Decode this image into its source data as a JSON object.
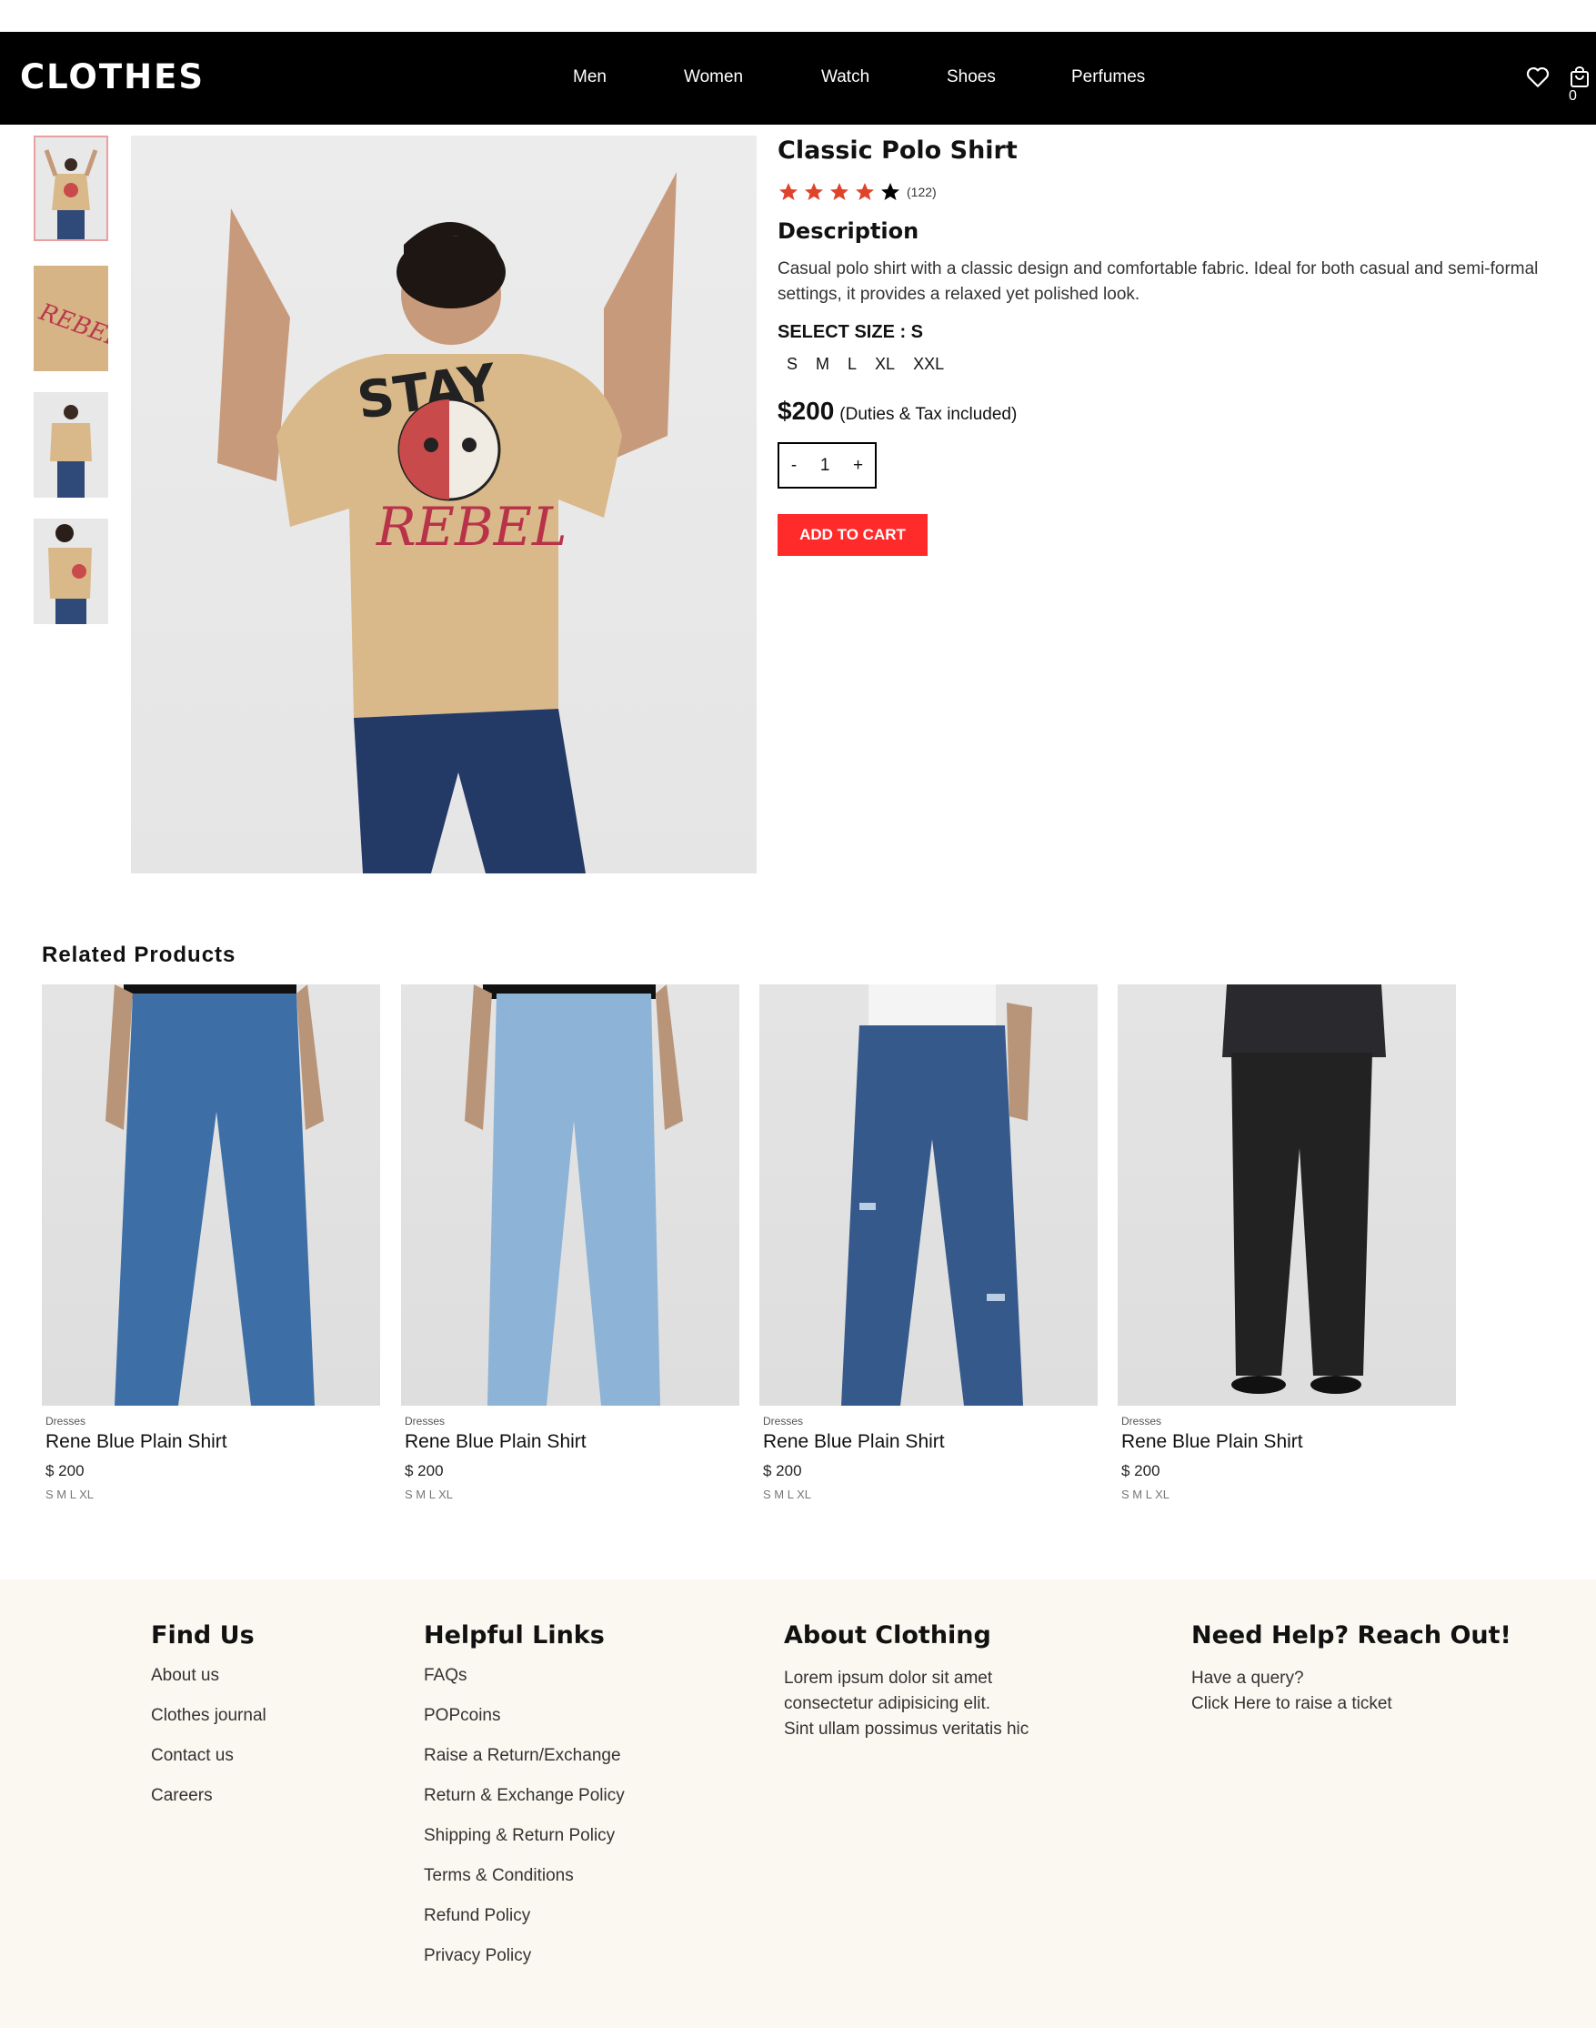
{
  "header": {
    "logo": "CLOTHES",
    "nav": [
      "Men",
      "Women",
      "Watch",
      "Shoes",
      "Perfumes"
    ],
    "cart_count": "0",
    "icons": [
      "heart-icon",
      "shopping-bag-icon"
    ]
  },
  "product": {
    "title": "Classic Polo Shirt",
    "rating": 4,
    "rating_max": 5,
    "review_count": "(122)",
    "description_heading": "Description",
    "description": "Casual polo shirt with a classic design and comfortable fabric. Ideal for both casual and semi-formal settings, it provides a relaxed yet polished look.",
    "size_heading": "SELECT SIZE : S",
    "sizes": [
      "S",
      "M",
      "L",
      "XL",
      "XXL"
    ],
    "price": "$200",
    "price_note": "(Duties & Tax included)",
    "qty_minus": "-",
    "qty_value": "1",
    "qty_plus": "+",
    "add_to_cart": "ADD TO CART"
  },
  "related": {
    "heading": "Related Products",
    "items": [
      {
        "category": "Dresses",
        "name": "Rene Blue Plain Shirt",
        "price": "$ 200",
        "sizes": "S M L XL"
      },
      {
        "category": "Dresses",
        "name": "Rene Blue Plain Shirt",
        "price": "$ 200",
        "sizes": "S M L XL"
      },
      {
        "category": "Dresses",
        "name": "Rene Blue Plain Shirt",
        "price": "$ 200",
        "sizes": "S M L XL"
      },
      {
        "category": "Dresses",
        "name": "Rene Blue Plain Shirt",
        "price": "$ 200",
        "sizes": "S M L XL"
      }
    ]
  },
  "footer": {
    "find_us": {
      "title": "Find Us",
      "links": [
        "About us",
        "Clothes journal",
        "Contact us",
        "Careers"
      ]
    },
    "helpful": {
      "title": "Helpful Links",
      "links": [
        "FAQs",
        "POPcoins",
        "Raise a Return/Exchange",
        "Return & Exchange Policy",
        "Shipping & Return Policy",
        "Terms & Conditions",
        "Refund Policy",
        "Privacy Policy"
      ]
    },
    "about": {
      "title": "About Clothing",
      "lines": [
        "Lorem ipsum dolor sit amet",
        "consectetur adipisicing elit.",
        "Sint ullam possimus veritatis hic"
      ]
    },
    "help": {
      "title": "Need Help? Reach Out!",
      "lines": [
        "Have a query?",
        "Click Here to raise a ticket"
      ]
    }
  },
  "colors": {
    "header_bg": "#000000",
    "accent_red": "#ff2b2b",
    "star_red": "#e0432b",
    "footer_bg": "#faf8f0",
    "tee": "#d9b98a",
    "denim_mid": "#3d6fa6",
    "denim_light": "#8db3d6",
    "denim_dark": "#35598a",
    "black_pants": "#222222"
  }
}
